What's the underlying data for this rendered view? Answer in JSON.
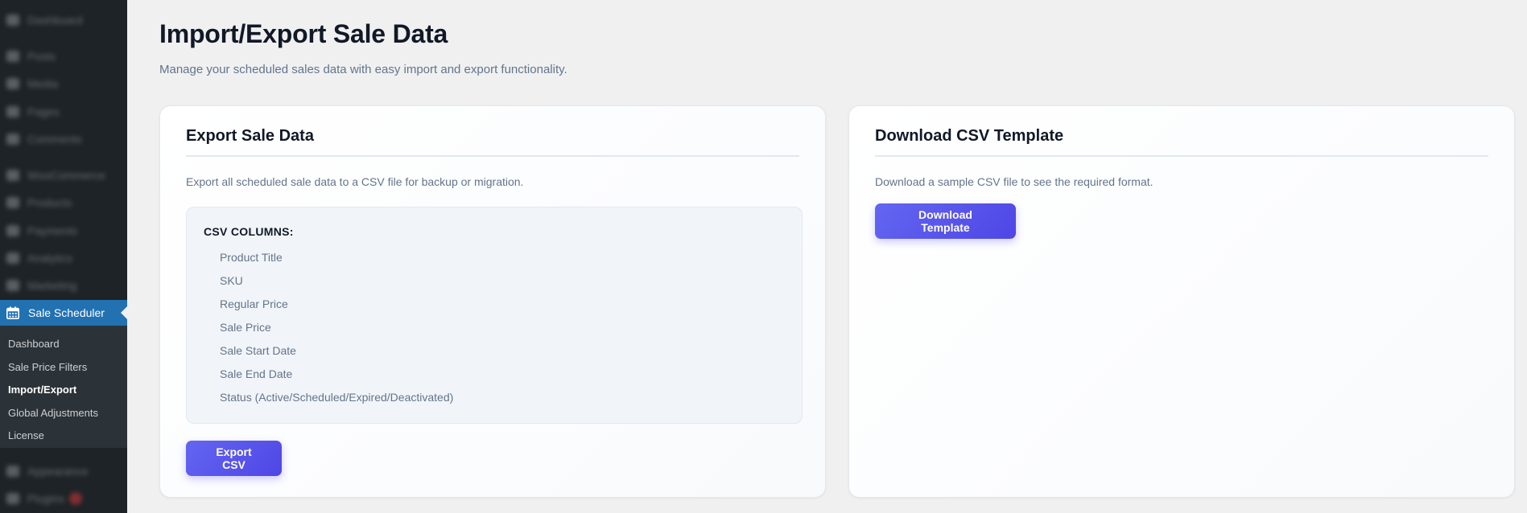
{
  "page": {
    "title": "Import/Export Sale Data",
    "description": "Manage your scheduled sales data with easy import and export functionality."
  },
  "sidebar": {
    "blurred_items": [
      "Dashboard",
      "Posts",
      "Media",
      "Pages",
      "Comments",
      "WooCommerce",
      "Products",
      "Payments",
      "Analytics",
      "Marketing",
      "Appearance",
      "Plugins"
    ],
    "active": {
      "label": "Sale Scheduler",
      "icon": "calendar-icon"
    },
    "submenu": [
      "Dashboard",
      "Sale Price Filters",
      "Import/Export",
      "Global Adjustments",
      "License"
    ],
    "current_submenu": "Import/Export"
  },
  "export_card": {
    "title": "Export Sale Data",
    "description": "Export all scheduled sale data to a CSV file for backup or migration.",
    "columns_heading": "CSV COLUMNS:",
    "columns": [
      "Product Title",
      "SKU",
      "Regular Price",
      "Sale Price",
      "Sale Start Date",
      "Sale End Date",
      "Status (Active/Scheduled/Expired/Deactivated)"
    ],
    "button_label": "Export CSV"
  },
  "template_card": {
    "title": "Download CSV Template",
    "description": "Download a sample CSV file to see the required format.",
    "button_label": "Download Template"
  },
  "colors": {
    "sidebar_bg": "#1d2327",
    "active_menu": "#2271b1",
    "button": "#5b5bf0",
    "page_bg": "#f0f0f1"
  }
}
